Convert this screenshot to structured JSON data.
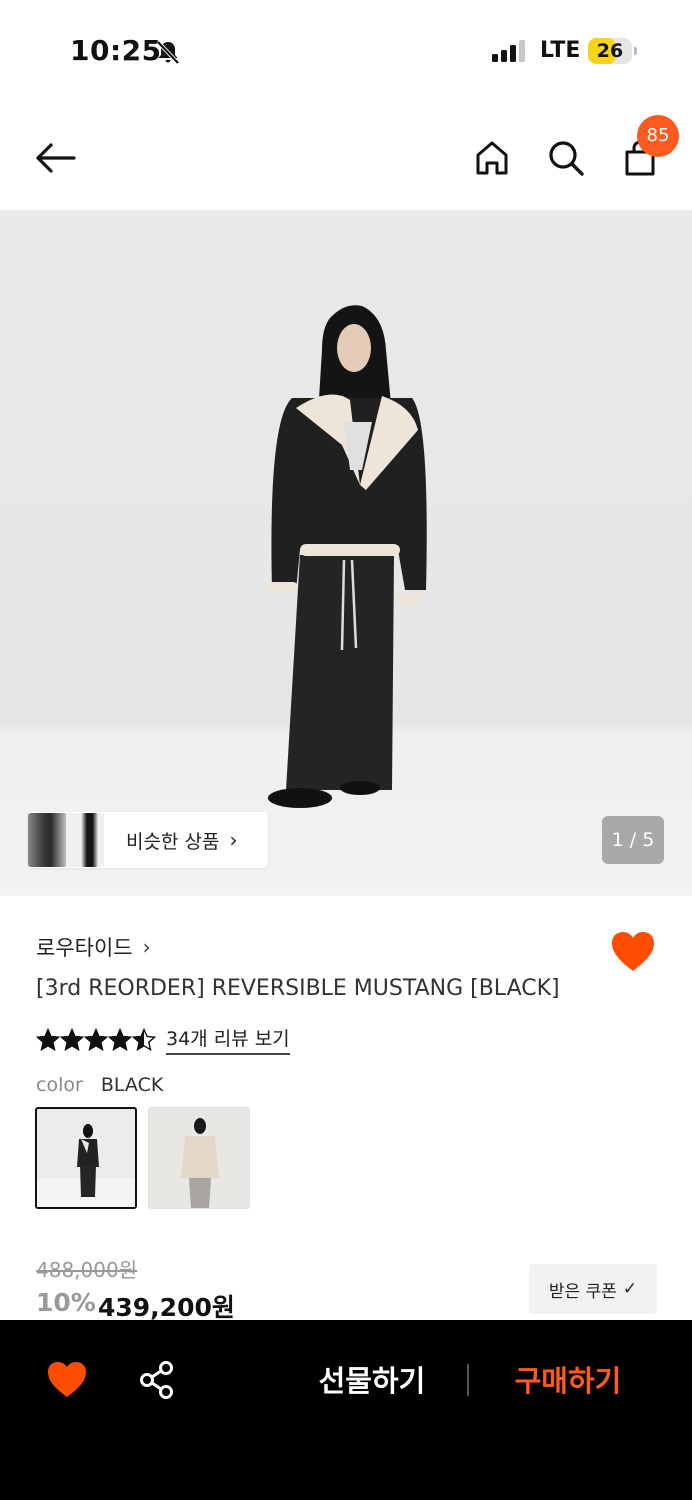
{
  "status_bar": {
    "time": "10:25",
    "carrier": "LTE",
    "battery": "26",
    "battery_level": 0.26,
    "icons": [
      "bell-off-icon",
      "signal-icon",
      "battery-icon"
    ]
  },
  "top_nav": {
    "icons": [
      "arrow-left-icon",
      "home-icon",
      "search-icon",
      "shopping-bag-icon"
    ],
    "cart_count": "85"
  },
  "gallery": {
    "similar_label": "비슷한 상품",
    "similar_chevron": "›",
    "counter": "1 / 5"
  },
  "product": {
    "brand": "로우타이드",
    "brand_chevron": "›",
    "title": "[3rd REORDER] REVERSIBLE MUSTANG [BLACK]",
    "rating": 4.5,
    "review_link": "34개 리뷰 보기",
    "color_label": "color",
    "color_value": "BLACK",
    "swatches": [
      "BLACK",
      "BEIGE"
    ],
    "original_price": "488,000원",
    "discount": "10%",
    "sale_price": "439,200원",
    "coupon_label": "받은 쿠폰",
    "coupon_check": "✓"
  },
  "colors": {
    "accent": "#ff5a1f",
    "heart": "#ff4d00",
    "bottom_bar": "#000000"
  },
  "bottom_bar": {
    "icons": [
      "heart-icon",
      "share-icon"
    ],
    "gift_label": "선물하기",
    "buy_label": "구매하기"
  }
}
